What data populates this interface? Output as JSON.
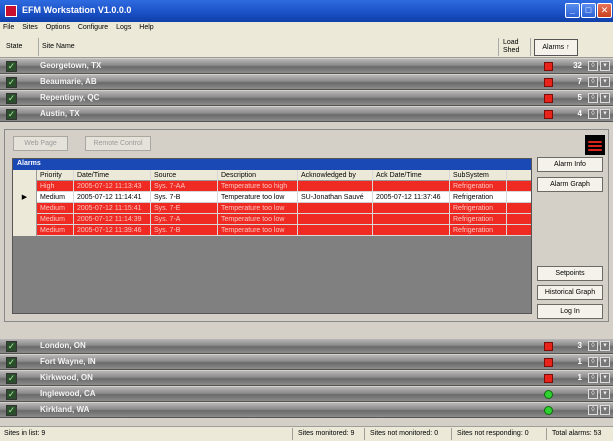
{
  "window": {
    "title": "EFM Workstation V1.0.0.0",
    "icon": "app-icon"
  },
  "menu": [
    "File",
    "Sites",
    "Options",
    "Configure",
    "Logs",
    "Help"
  ],
  "header": {
    "state": "State",
    "site_name": "Site Name",
    "load_shed_1": "Load",
    "load_shed_2": "Shed",
    "alarms": "Alarms ↑"
  },
  "sites_top": [
    {
      "name": "Georgetown, TX",
      "indicator": "red",
      "count": "32"
    },
    {
      "name": "Beaumarie, AB",
      "indicator": "red",
      "count": "7"
    },
    {
      "name": "Repentigny, QC",
      "indicator": "red",
      "count": "5"
    },
    {
      "name": "Austin, TX",
      "indicator": "red",
      "count": "4"
    }
  ],
  "panel": {
    "web_page": "Web Page",
    "remote_control": "Remote Control",
    "alarms_title": "Alarms",
    "columns": [
      "Priority",
      "Date/Time",
      "Source",
      "Description",
      "Acknowledged by",
      "Ack Date/Time",
      "SubSystem"
    ],
    "rows": [
      {
        "style": "red",
        "sel": "",
        "cells": [
          "High",
          "2005-07-12 11:13:43",
          "Sys. 7-AA",
          "Temperature too high",
          "",
          "",
          "Refrigeration"
        ]
      },
      {
        "style": "white",
        "sel": "▶",
        "cells": [
          "Medium",
          "2005-07-12 11:14:41",
          "Sys. 7-B",
          "Temperature too low",
          "SU-Jonathan Sauvé",
          "2005-07-12 11:37:46",
          "Refrigeration"
        ]
      },
      {
        "style": "red",
        "sel": "",
        "cells": [
          "Medium",
          "2005-07-12 11:15:41",
          "Sys. 7-E",
          "Temperature too low",
          "",
          "",
          "Refrigeration"
        ]
      },
      {
        "style": "red",
        "sel": "",
        "cells": [
          "Medium",
          "2005-07-12 11:14:39",
          "Sys. 7-A",
          "Temperature too low",
          "",
          "",
          "Refrigeration"
        ]
      },
      {
        "style": "red",
        "sel": "",
        "cells": [
          "Medium",
          "2005-07-12 11:39:46",
          "Sys. 7-B",
          "Temperature too low",
          "",
          "",
          "Refrigeration"
        ]
      }
    ],
    "buttons_right": {
      "alarm_info": "Alarm Info",
      "alarm_graph": "Alarm Graph",
      "setpoints": "Setpoints",
      "historical_graph": "Historical Graph",
      "log_in": "Log In"
    }
  },
  "sites_bottom": [
    {
      "name": "London, ON",
      "indicator": "red",
      "count": "3"
    },
    {
      "name": "Fort Wayne, IN",
      "indicator": "red",
      "count": "1"
    },
    {
      "name": "Kirkwood, ON",
      "indicator": "red",
      "count": "1"
    },
    {
      "name": "Inglewood, CA",
      "indicator": "green",
      "count": ""
    },
    {
      "name": "Kirkland, WA",
      "indicator": "green",
      "count": ""
    }
  ],
  "status": {
    "sites_in_list": "Sites in list: 9",
    "monitored": "Sites monitored: 9",
    "not_monitored": "Sites not monitored: 0",
    "not_responding": "Sites not responding: 0",
    "total_alarms": "Total alarms: 53"
  },
  "colors": {
    "alarm_red": "#ee2a22",
    "title_blue": "#1a4fc4",
    "ok_green": "#2fd02f"
  }
}
